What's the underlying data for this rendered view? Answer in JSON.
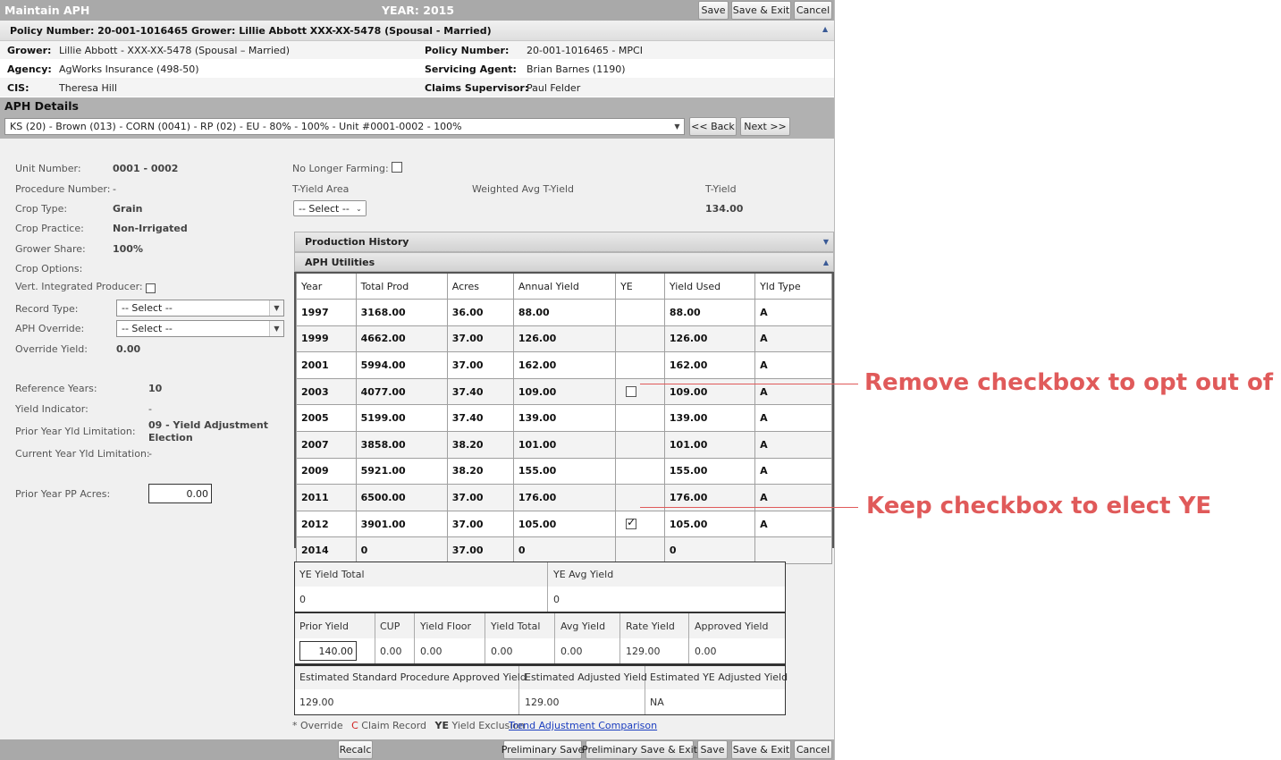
{
  "header": {
    "title": "Maintain APH",
    "year": "YEAR: 2015",
    "save": "Save",
    "save_exit": "Save & Exit",
    "cancel": "Cancel"
  },
  "policy_bar": {
    "text": "Policy Number: 20-001-1016465 Grower: Lillie Abbott XXX-XX-5478 (Spousal - Married)"
  },
  "policy_info": {
    "grower_label": "Grower:",
    "grower": "Lillie Abbott - XXX-XX-5478 (Spousal – Married)",
    "agency_label": "Agency:",
    "agency": "AgWorks Insurance (498-50)",
    "cis_label": "CIS:",
    "cis": "Theresa Hill",
    "policy_label": "Policy Number:",
    "policy": "20-001-1016465 - MPCI",
    "agent_label": "Servicing Agent:",
    "agent": "Brian Barnes (1190)",
    "claims_label": "Claims Supervisor:",
    "claims": "Paul Felder"
  },
  "aph_details": {
    "title": "APH Details",
    "unit_select": "KS (20) - Brown (013) - CORN (0041) - RP (02) - EU - 80% - 100% - Unit #0001-0002 - 100%",
    "back": "<< Back",
    "next": "Next >>"
  },
  "left": {
    "unit_number_label": "Unit Number:",
    "unit_number": "0001 - 0002",
    "procedure_label": "Procedure Number:",
    "procedure": "-",
    "crop_type_label": "Crop Type:",
    "crop_type": "Grain",
    "crop_practice_label": "Crop Practice:",
    "crop_practice": "Non-Irrigated",
    "grower_share_label": "Grower Share:",
    "grower_share": "100%",
    "crop_options_label": "Crop Options:",
    "vert_label": "Vert. Integrated Producer:",
    "record_type_label": "Record Type:",
    "record_type": "-- Select --",
    "aph_override_label": "APH Override:",
    "aph_override": "-- Select --",
    "override_yield_label": "Override Yield:",
    "override_yield": "0.00",
    "ref_years_label": "Reference Years:",
    "ref_years": "10",
    "yield_indicator_label": "Yield Indicator:",
    "yield_indicator": "-",
    "prior_limit_label": "Prior Year Yld Limitation:",
    "prior_limit_1": "09 - Yield Adjustment",
    "prior_limit_2": "Election",
    "current_limit_label": "Current Year Yld Limitation:",
    "current_limit": "-",
    "pp_acres_label": "Prior Year PP Acres:",
    "pp_acres": "0.00"
  },
  "mid": {
    "no_longer_label": "No Longer Farming:",
    "tyield_area_label": "T-Yield Area",
    "tyield_area": "-- Select --",
    "weighted_label": "Weighted Avg T-Yield",
    "tyield_label": "T-Yield",
    "tyield": "134.00",
    "production_history": "Production History",
    "aph_utilities": "APH Utilities"
  },
  "yield_table": {
    "headers": [
      "Year",
      "Total Prod",
      "Acres",
      "Annual Yield",
      "YE",
      "Yield Used",
      "Yld Type"
    ],
    "rows": [
      {
        "year": "1997",
        "prod": "3168.00",
        "acres": "36.00",
        "annual": "88.00",
        "ye": "",
        "used": "88.00",
        "type": "A"
      },
      {
        "year": "1999",
        "prod": "4662.00",
        "acres": "37.00",
        "annual": "126.00",
        "ye": "",
        "used": "126.00",
        "type": "A"
      },
      {
        "year": "2001",
        "prod": "5994.00",
        "acres": "37.00",
        "annual": "162.00",
        "ye": "",
        "used": "162.00",
        "type": "A"
      },
      {
        "year": "2003",
        "prod": "4077.00",
        "acres": "37.40",
        "annual": "109.00",
        "ye": "unchecked",
        "used": "109.00",
        "type": "A"
      },
      {
        "year": "2005",
        "prod": "5199.00",
        "acres": "37.40",
        "annual": "139.00",
        "ye": "",
        "used": "139.00",
        "type": "A"
      },
      {
        "year": "2007",
        "prod": "3858.00",
        "acres": "38.20",
        "annual": "101.00",
        "ye": "",
        "used": "101.00",
        "type": "A"
      },
      {
        "year": "2009",
        "prod": "5921.00",
        "acres": "38.20",
        "annual": "155.00",
        "ye": "",
        "used": "155.00",
        "type": "A"
      },
      {
        "year": "2011",
        "prod": "6500.00",
        "acres": "37.00",
        "annual": "176.00",
        "ye": "",
        "used": "176.00",
        "type": "A"
      },
      {
        "year": "2012",
        "prod": "3901.00",
        "acres": "37.00",
        "annual": "105.00",
        "ye": "checked",
        "used": "105.00",
        "type": "A"
      },
      {
        "year": "2014",
        "prod": "0",
        "acres": "37.00",
        "annual": "0",
        "ye": "",
        "used": "0",
        "type": ""
      }
    ]
  },
  "summary": {
    "ye_total_label": "YE Yield Total",
    "ye_total": "0",
    "ye_avg_label": "YE Avg Yield",
    "ye_avg": "0",
    "prior_yield_label": "Prior Yield",
    "prior_yield": "140.00",
    "cup_label": "CUP",
    "cup": "0.00",
    "floor_label": "Yield Floor",
    "floor": "0.00",
    "total_label": "Yield Total",
    "total": "0.00",
    "avg_label": "Avg Yield",
    "avg": "0.00",
    "rate_label": "Rate Yield",
    "rate": "129.00",
    "approved_label": "Approved Yield",
    "approved": "0.00",
    "est_std_label": "Estimated Standard Procedure Approved Yield",
    "est_std": "129.00",
    "est_adj_label": "Estimated Adjusted Yield",
    "est_adj": "129.00",
    "est_ye_label": "Estimated YE Adjusted Yield",
    "est_ye": "NA"
  },
  "legend": {
    "override_mark": "*",
    "override": "Override",
    "claim_mark": "C",
    "claim": "Claim Record",
    "ye_mark": "YE",
    "ye": "Yield Exclusion",
    "trend_link": "Trend Adjustment Comparison"
  },
  "footer": {
    "recalc": "Recalc",
    "prelim_save": "Preliminary Save",
    "prelim_save_exit": "Preliminary Save & Exit",
    "save": "Save",
    "save_exit": "Save & Exit",
    "cancel": "Cancel"
  },
  "callouts": {
    "remove": "Remove checkbox to opt out of YE",
    "keep": "Keep checkbox to elect YE"
  },
  "colors": {
    "callout": "#e05a5a",
    "header_bar": "#a9a9a9",
    "link": "#1a3dbf"
  }
}
